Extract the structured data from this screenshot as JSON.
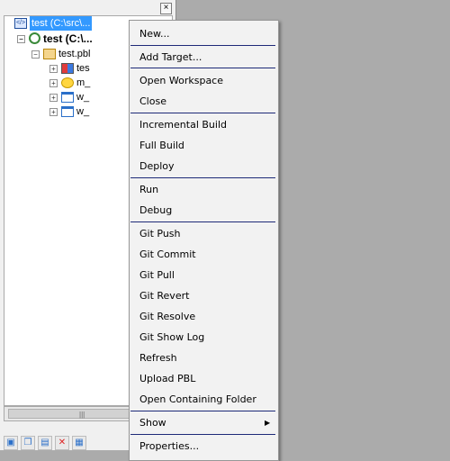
{
  "explorer": {
    "close_label": "×",
    "items": [
      {
        "label": "test (C:\\src\\...",
        "icon": "workspace-icon"
      },
      {
        "label": "test (C:\\...",
        "icon": "target-icon"
      },
      {
        "label": "test.pbl",
        "icon": "library-icon"
      },
      {
        "label": "tes",
        "icon": "application-icon"
      },
      {
        "label": "m_",
        "icon": "menu-object-icon"
      },
      {
        "label": "w_",
        "icon": "window-object-icon"
      },
      {
        "label": "w_",
        "icon": "window-object-icon"
      }
    ],
    "scrollbar_grip": "|||"
  },
  "context_menu": {
    "items": [
      "New...",
      "Add Target...",
      "Open Workspace",
      "Close",
      "Incremental Build",
      "Full Build",
      "Deploy",
      "Run",
      "Debug",
      "Git Push",
      "Git Commit",
      "Git Pull",
      "Git Revert",
      "Git Resolve",
      "Git Show Log",
      "Refresh",
      "Upload PBL",
      "Open Containing Folder",
      "Show",
      "Properties..."
    ],
    "submenu_arrow": "▶"
  },
  "colors": {
    "selection": "#3399ff",
    "separator": "#1e2a78",
    "desktop": "#ababab"
  }
}
